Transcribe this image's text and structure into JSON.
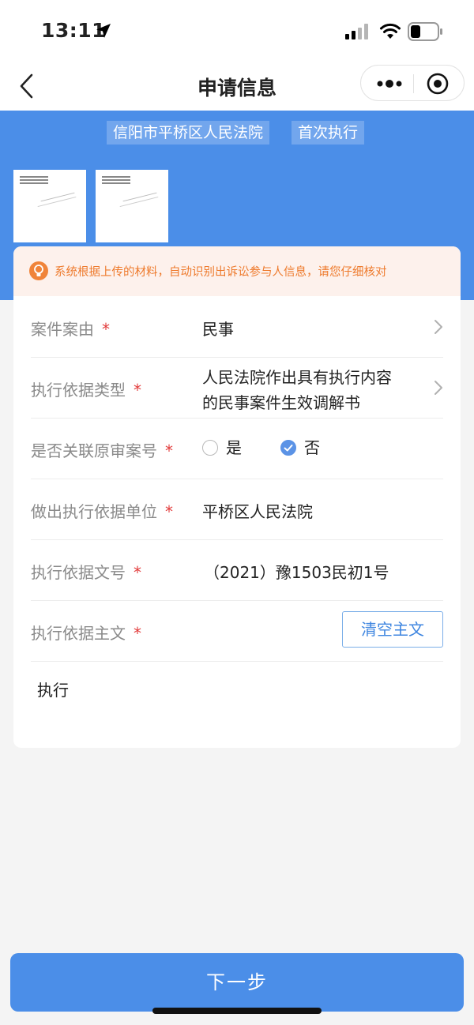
{
  "status": {
    "time": "13:11"
  },
  "nav": {
    "title": "申请信息"
  },
  "header": {
    "tags": [
      "信阳市平桥区人民法院",
      "首次执行"
    ]
  },
  "notice": {
    "text": "系统根据上传的材料，自动识别出诉讼参与人信息，请您仔细核对"
  },
  "form": {
    "required_mark": "*",
    "case_cause": {
      "label": "案件案由",
      "value": "民事"
    },
    "basis_type": {
      "label": "执行依据类型",
      "value_line1": "人民法院作出具有执行内容",
      "value_line2": "的民事案件生效调解书"
    },
    "link_original": {
      "label": "是否关联原审案号",
      "options": [
        "是",
        "否"
      ],
      "selected": "否"
    },
    "basis_unit": {
      "label": "做出执行依据单位",
      "value": "平桥区人民法院"
    },
    "basis_number": {
      "label": "执行依据文号",
      "value": "（2021）豫1503民初1号"
    },
    "basis_text": {
      "label": "执行依据主文",
      "clear_button": "清空主文",
      "value": "执行"
    }
  },
  "footer": {
    "next_button": "下一步"
  },
  "colors": {
    "primary": "#4b8ee8",
    "notice_text": "#ee7a2c",
    "required": "#e23b3b"
  }
}
